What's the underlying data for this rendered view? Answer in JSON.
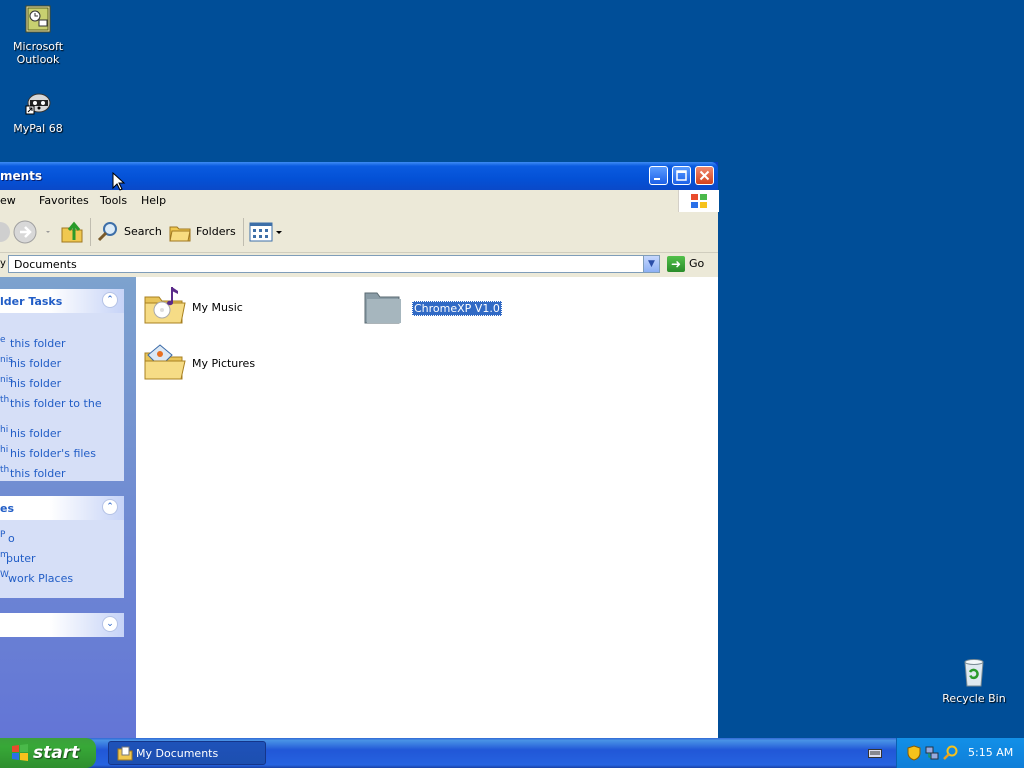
{
  "desktop": {
    "icons": [
      {
        "label_line1": "Microsoft",
        "label_line2": "Outlook"
      },
      {
        "label_line1": "MyPal 68",
        "label_line2": ""
      },
      {
        "label_line1": "Recycle Bin",
        "label_line2": ""
      }
    ]
  },
  "window": {
    "title": "ments",
    "menu": [
      "ew",
      "Favorites",
      "Tools",
      "Help"
    ],
    "toolbar": {
      "search_label": "Search",
      "folders_label": "Folders"
    },
    "address": {
      "value": "Documents",
      "fragment": "y D",
      "go_label": "Go"
    },
    "task_pane": {
      "folder_tasks": {
        "title": "lder Tasks",
        "links": [
          "this folder",
          "his folder",
          "his folder",
          "this folder to the",
          "his folder",
          "his folder's files",
          "this folder"
        ],
        "clipped_prefixes": [
          "e",
          "nis",
          "nis",
          "th",
          "hi",
          "hi",
          "th"
        ]
      },
      "other_places": {
        "title": "es",
        "links": [
          "o",
          "puter",
          "work Places"
        ],
        "clipped_prefixes": [
          "P",
          "m",
          "W"
        ]
      }
    },
    "items": [
      {
        "label": "My Music",
        "icon": "music-folder-icon"
      },
      {
        "label": "ChromeXP V1.0",
        "icon": "folder-icon",
        "selected": true
      },
      {
        "label": "My Pictures",
        "icon": "pictures-folder-icon"
      }
    ]
  },
  "taskbar": {
    "start_label": "start",
    "task_button": "My Documents",
    "clock": "5:15 AM"
  },
  "colors": {
    "desktop": "#004e98",
    "selection": "#316ac5",
    "link": "#215dc6"
  }
}
